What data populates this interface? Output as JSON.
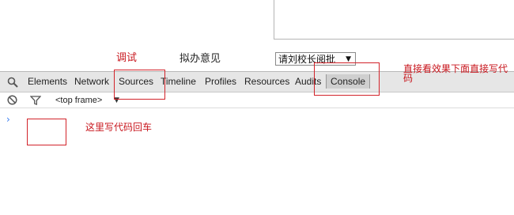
{
  "page": {
    "debug_note": "调试",
    "proposal_label": "拟办意见",
    "approver_select": {
      "value": "请刘校长阅批"
    },
    "console_note": "直接看效果下面直接写代码",
    "enter_note": "这里写代码回车"
  },
  "devtools": {
    "tabs": [
      {
        "label": "Elements"
      },
      {
        "label": "Network"
      },
      {
        "label": "Sources"
      },
      {
        "label": "Timeline"
      },
      {
        "label": "Profiles"
      },
      {
        "label": "Resources"
      },
      {
        "label": "Audits"
      },
      {
        "label": "Console",
        "active": true
      }
    ],
    "frame_select": "<top frame>",
    "prompt": "›"
  },
  "colors": {
    "annotation": "#d2232a",
    "toolbar_bg": "#e6e6e6",
    "active_tab_bg": "#cfcfcf",
    "prompt": "#367cf1"
  },
  "icons": {
    "search": "search-icon",
    "clear": "clear-console-icon",
    "filter": "filter-icon",
    "dropdown": "chevron-down-icon"
  }
}
